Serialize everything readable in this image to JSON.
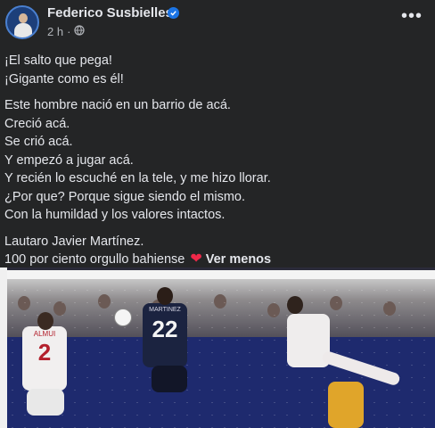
{
  "post": {
    "author": "Federico Susbielles",
    "time": "2 h",
    "lines": [
      [
        "¡El salto que pega!",
        "¡Gigante como es él!"
      ],
      [
        "Este hombre nació en un barrio de acá.",
        "Creció acá.",
        "Se crió acá.",
        "Y empezó a jugar acá.",
        "Y recién lo escuché en la tele, y me hizo llorar.",
        "¿Por que? Porque sigue siendo el mismo.",
        "Con la humildad y los valores intactos."
      ]
    ],
    "closing": [
      "Lautaro Javier Martínez."
    ],
    "last_line": "100 por ciento orgullo bahiense",
    "see_less": "Ver menos"
  },
  "photo": {
    "jersey_left": "2",
    "jersey_center": "22",
    "jersey_left_name": "ALMUI",
    "jersey_center_name": "MARTINEZ"
  },
  "colors": {
    "background": "#242526",
    "text": "#e4e6eb",
    "secondary": "#b0b3b8",
    "verified": "#1b74e4",
    "heart": "#f02849"
  },
  "icons": [
    "avatar",
    "verified-badge-icon",
    "globe-icon",
    "more-options-icon",
    "heart-emoji-icon"
  ]
}
